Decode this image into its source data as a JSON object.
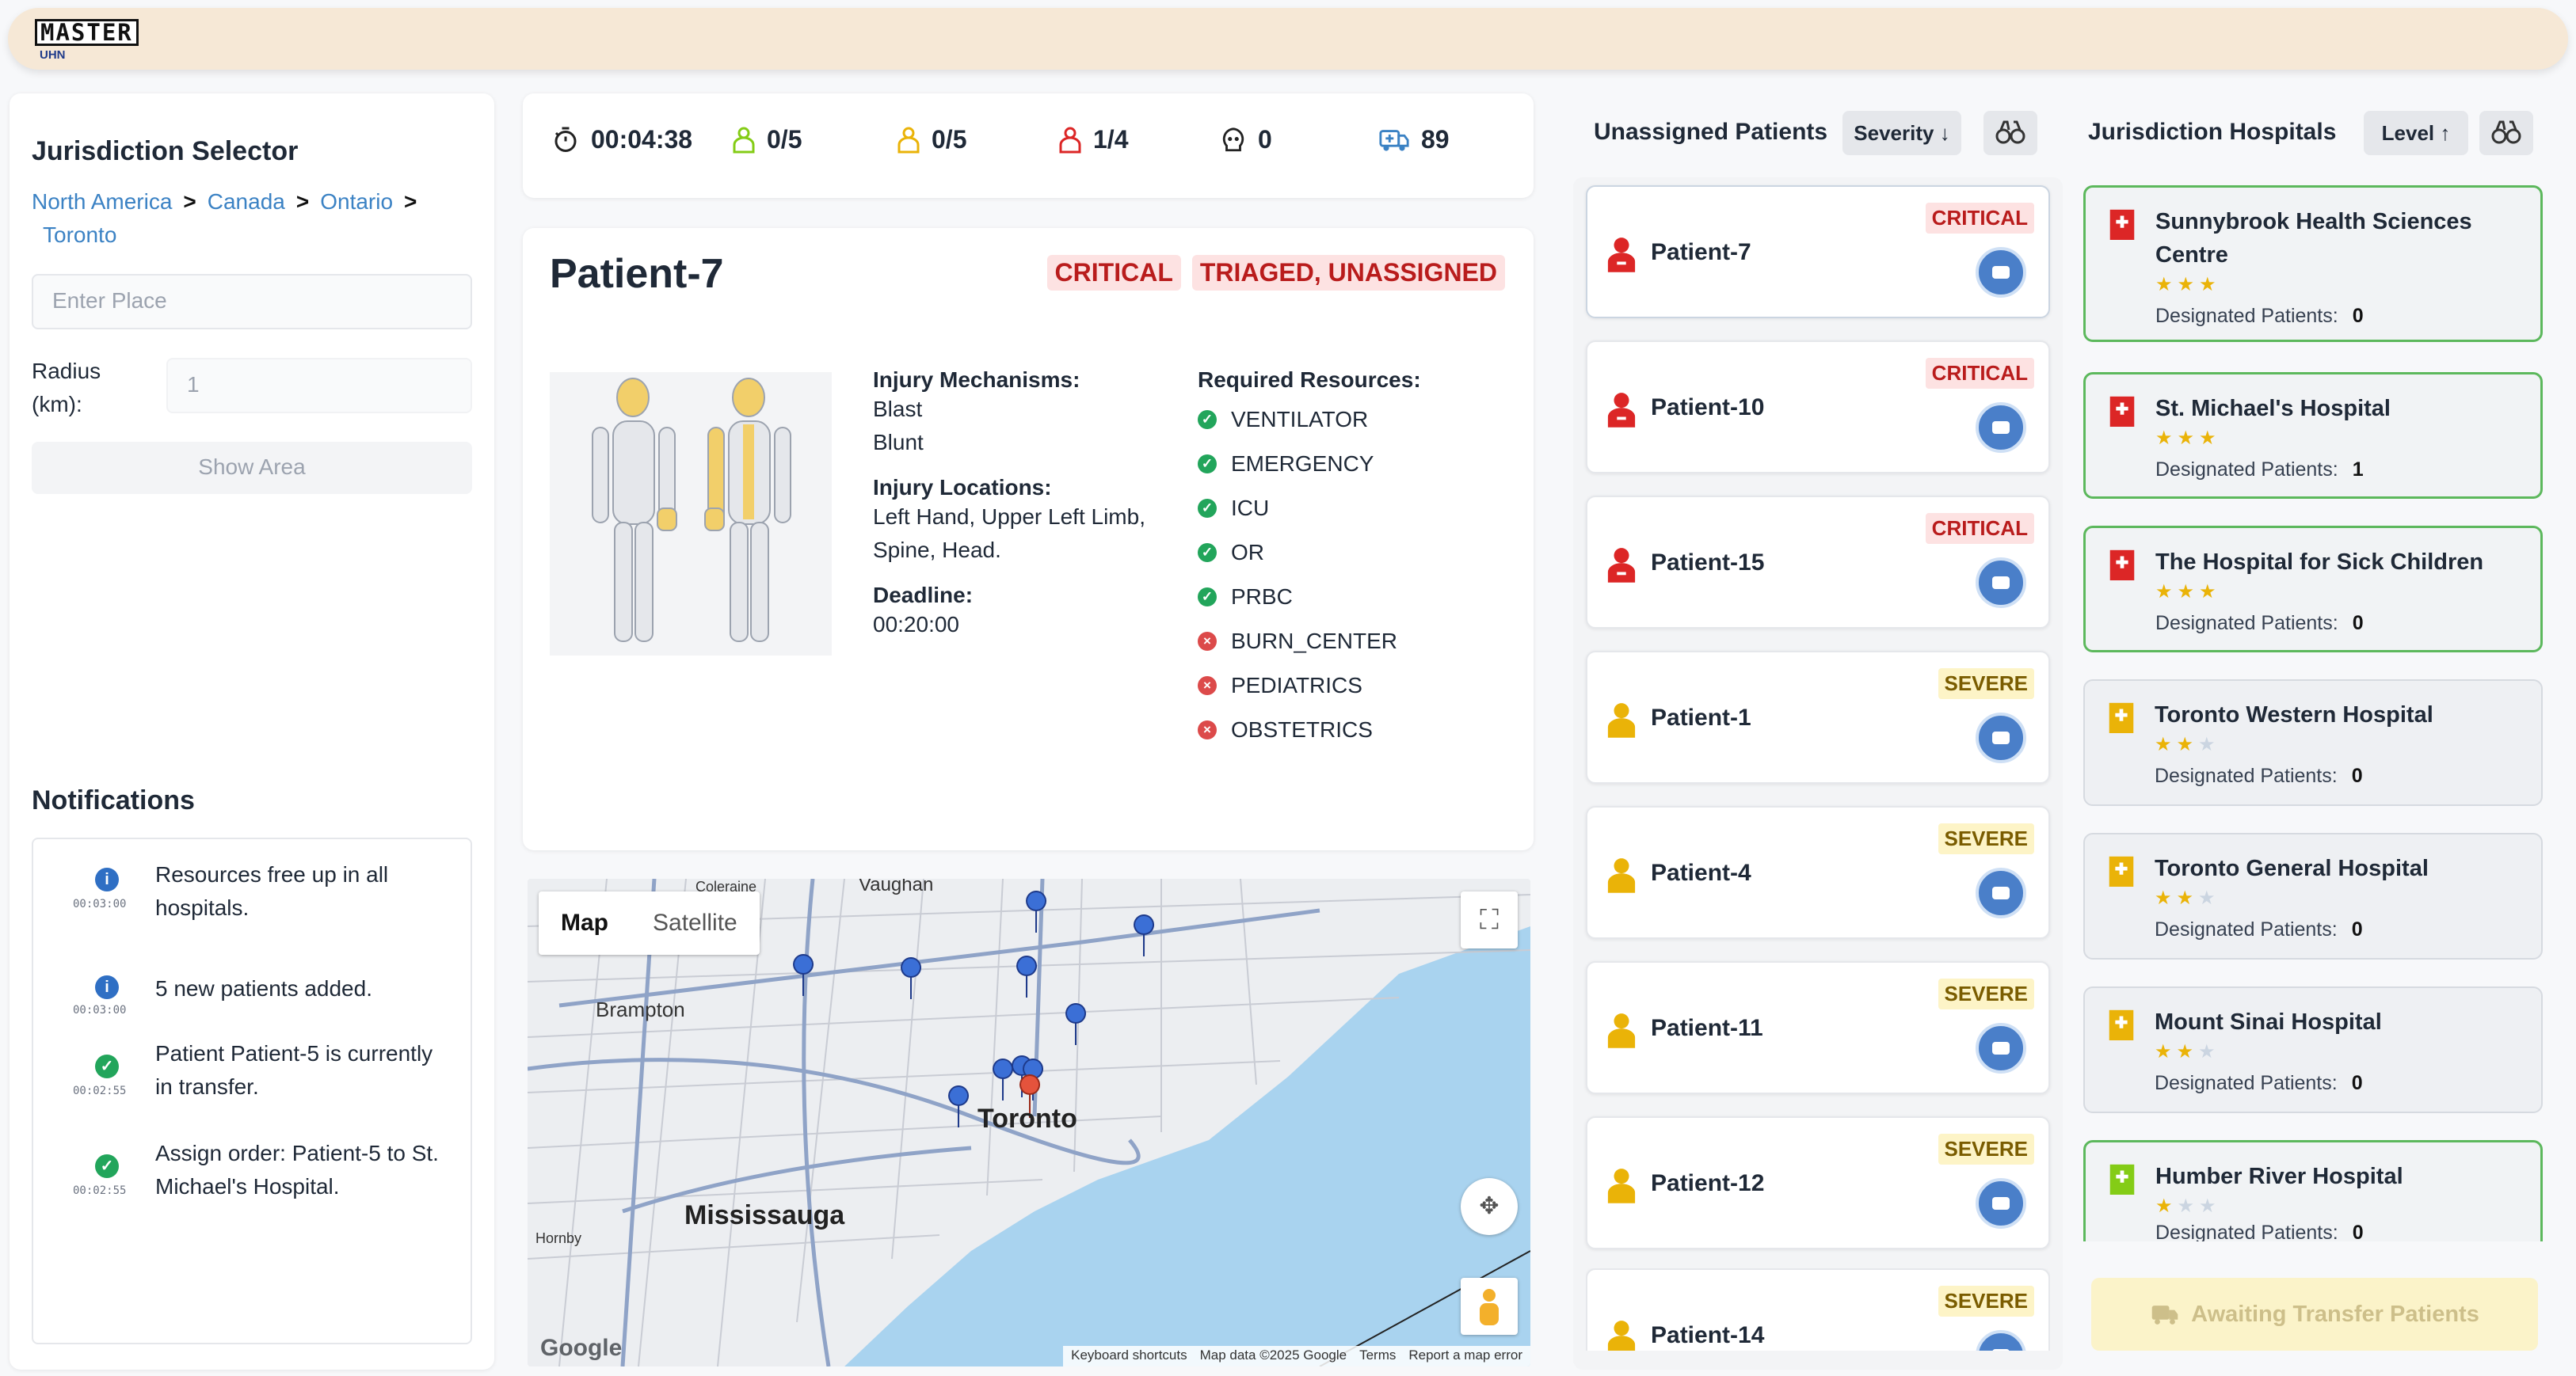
{
  "logo": {
    "line1": "MASTER",
    "line2": "UHN"
  },
  "jurisdiction": {
    "title": "Jurisdiction Selector",
    "breadcrumb": [
      "North America",
      "Canada",
      "Ontario",
      "Toronto"
    ],
    "place_placeholder": "Enter Place",
    "radius_label_1": "Radius",
    "radius_label_2": "(km):",
    "radius_placeholder": "1",
    "show_area_label": "Show Area"
  },
  "notifications": {
    "title": "Notifications",
    "items": [
      {
        "type": "info",
        "time": "00:03:00",
        "text1": "Resources free up in all",
        "text2": "hospitals."
      },
      {
        "type": "info",
        "time": "00:03:00",
        "text1": "5 new patients added.",
        "text2": ""
      },
      {
        "type": "success",
        "time": "00:02:55",
        "text1": "Patient Patient-5 is currently",
        "text2": "in transfer."
      },
      {
        "type": "success",
        "time": "00:02:55",
        "text1": "Assign order: Patient-5 to St.",
        "text2": "Michael's Hospital."
      }
    ]
  },
  "stats": {
    "timer": "00:04:38",
    "green": "0/5",
    "yellow": "0/5",
    "red": "1/4",
    "deceased": "0",
    "ambulances": "89"
  },
  "patient": {
    "name": "Patient-7",
    "severity": "CRITICAL",
    "status": "TRIAGED, UNASSIGNED",
    "mechanisms_label": "Injury Mechanisms:",
    "mechanisms": [
      "Blast",
      "Blunt"
    ],
    "locations_label": "Injury Locations:",
    "locations_1": "Left Hand, Upper Left Limb,",
    "locations_2": "Spine, Head.",
    "deadline_label": "Deadline:",
    "deadline": "00:20:00",
    "resources_label": "Required Resources:",
    "resources": [
      {
        "name": "VENTILATOR",
        "ok": true
      },
      {
        "name": "EMERGENCY",
        "ok": true
      },
      {
        "name": "ICU",
        "ok": true
      },
      {
        "name": "OR",
        "ok": true
      },
      {
        "name": "PRBC",
        "ok": true
      },
      {
        "name": "BURN_CENTER",
        "ok": false
      },
      {
        "name": "PEDIATRICS",
        "ok": false
      },
      {
        "name": "OBSTETRICS",
        "ok": false
      }
    ]
  },
  "map": {
    "tab_map": "Map",
    "tab_satellite": "Satellite",
    "labels": {
      "toronto": "Toronto",
      "mississauga": "Mississauga",
      "brampton": "Brampton",
      "vaughan": "Vaughan",
      "coleraine": "Coleraine",
      "hornby": "Hornby"
    },
    "footer": {
      "shortcuts": "Keyboard shortcuts",
      "data": "Map data ©2025 Google",
      "terms": "Terms",
      "report": "Report a map error"
    },
    "google": "Google"
  },
  "unassigned": {
    "title": "Unassigned Patients",
    "sort_label": "Severity ↓",
    "patients": [
      {
        "name": "Patient-7",
        "severity": "CRITICAL"
      },
      {
        "name": "Patient-10",
        "severity": "CRITICAL"
      },
      {
        "name": "Patient-15",
        "severity": "CRITICAL"
      },
      {
        "name": "Patient-1",
        "severity": "SEVERE"
      },
      {
        "name": "Patient-4",
        "severity": "SEVERE"
      },
      {
        "name": "Patient-11",
        "severity": "SEVERE"
      },
      {
        "name": "Patient-12",
        "severity": "SEVERE"
      },
      {
        "name": "Patient-14",
        "severity": "SEVERE"
      }
    ]
  },
  "hospitals": {
    "title": "Jurisdiction Hospitals",
    "sort_label": "Level ↑",
    "designated_label": "Designated Patients:",
    "items": [
      {
        "name": "Sunnybrook Health Sciences Centre",
        "level": 3,
        "designated": "0",
        "selected": true,
        "color": "#dc2626"
      },
      {
        "name": "St. Michael's Hospital",
        "level": 3,
        "designated": "1",
        "selected": true,
        "color": "#dc2626"
      },
      {
        "name": "The Hospital for Sick Children",
        "level": 3,
        "designated": "0",
        "selected": true,
        "color": "#dc2626"
      },
      {
        "name": "Toronto Western Hospital",
        "level": 2,
        "designated": "0",
        "selected": false,
        "color": "#eab308"
      },
      {
        "name": "Toronto General Hospital",
        "level": 2,
        "designated": "0",
        "selected": false,
        "color": "#eab308"
      },
      {
        "name": "Mount Sinai Hospital",
        "level": 2,
        "designated": "0",
        "selected": false,
        "color": "#eab308"
      },
      {
        "name": "Humber River Hospital",
        "level": 1,
        "designated": "0",
        "selected": true,
        "color": "#84cc16"
      }
    ],
    "transfer_button": "Awaiting Transfer Patients"
  },
  "colors": {
    "critical": "#dc2626",
    "severe": "#eab308",
    "minor": "#84cc16",
    "accent": "#3b82c4",
    "ok": "#22a55b",
    "fail": "#dc4a4a"
  }
}
